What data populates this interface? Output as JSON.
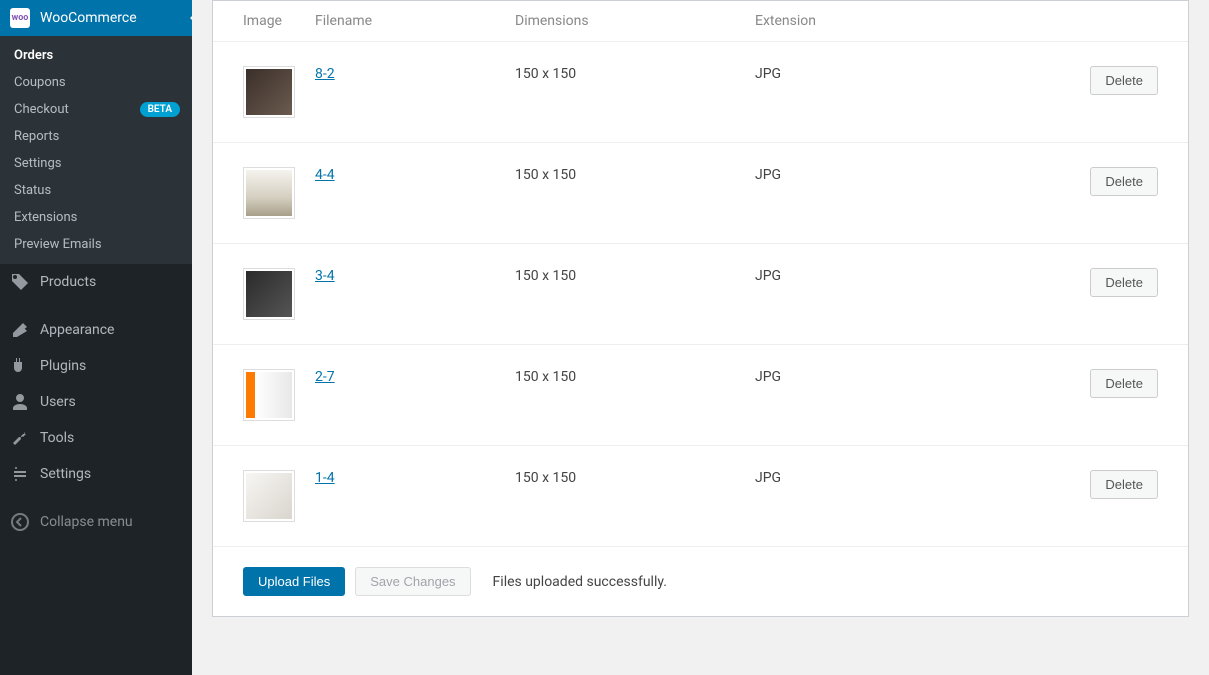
{
  "sidebar": {
    "woocommerce": {
      "label": "WooCommerce",
      "submenu": [
        {
          "label": "Orders",
          "current": true
        },
        {
          "label": "Coupons"
        },
        {
          "label": "Checkout",
          "badge": "BETA"
        },
        {
          "label": "Reports"
        },
        {
          "label": "Settings"
        },
        {
          "label": "Status"
        },
        {
          "label": "Extensions"
        },
        {
          "label": "Preview Emails"
        }
      ]
    },
    "items": [
      {
        "label": "Products",
        "icon": "products"
      },
      {
        "label": "Appearance",
        "icon": "appearance"
      },
      {
        "label": "Plugins",
        "icon": "plugins"
      },
      {
        "label": "Users",
        "icon": "users"
      },
      {
        "label": "Tools",
        "icon": "tools"
      },
      {
        "label": "Settings",
        "icon": "settings"
      }
    ],
    "collapse_label": "Collapse menu"
  },
  "table": {
    "headers": {
      "image": "Image",
      "filename": "Filename",
      "dimensions": "Dimensions",
      "extension": "Extension"
    },
    "rows": [
      {
        "filename": "8-2",
        "dimensions": "150 x 150",
        "extension": "JPG",
        "thumb_bg": "linear-gradient(135deg,#3a2f2a 0%,#6b5b4f 100%)"
      },
      {
        "filename": "4-4",
        "dimensions": "150 x 150",
        "extension": "JPG",
        "thumb_bg": "linear-gradient(180deg,#f5f3ee 0%,#d4cfc0 60%,#a89f8a 100%)"
      },
      {
        "filename": "3-4",
        "dimensions": "150 x 150",
        "extension": "JPG",
        "thumb_bg": "linear-gradient(135deg,#2a2a2a 0%,#555 100%)"
      },
      {
        "filename": "2-7",
        "dimensions": "150 x 150",
        "extension": "JPG",
        "thumb_bg": "linear-gradient(90deg,#ff7a00 0%,#ff7a00 20%,#ffffff 20%,#e8e8e8 100%)"
      },
      {
        "filename": "1-4",
        "dimensions": "150 x 150",
        "extension": "JPG",
        "thumb_bg": "linear-gradient(135deg,#f8f6f3 0%,#d9d5ce 100%)"
      }
    ],
    "delete_label": "Delete"
  },
  "actions": {
    "upload_label": "Upload Files",
    "save_label": "Save Changes",
    "status_text": "Files uploaded successfully."
  }
}
